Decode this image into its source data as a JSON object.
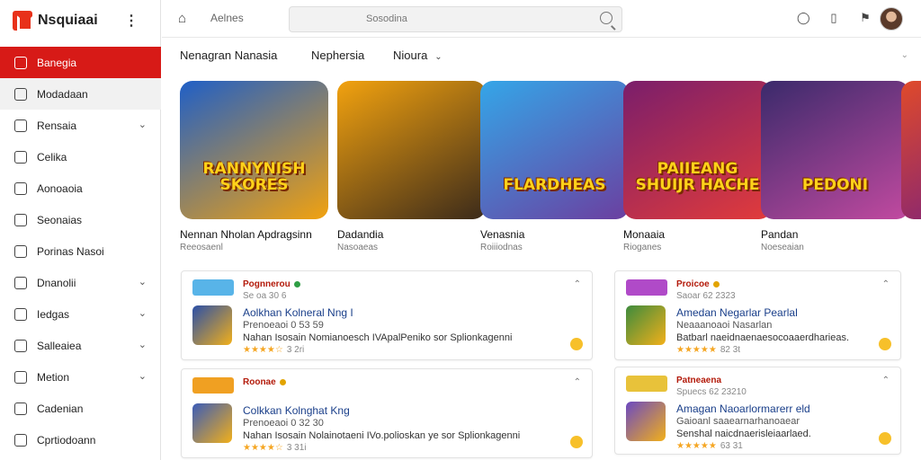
{
  "brand": {
    "name": "Nsquiaai"
  },
  "sidebar": {
    "items": [
      {
        "label": "Banegia",
        "icon": "home-icon",
        "active": true,
        "chevron": false
      },
      {
        "label": "Modadaan",
        "icon": "library-icon",
        "active": false,
        "chevron": false
      },
      {
        "label": "Rensaia",
        "icon": "home-outline-icon",
        "active": false,
        "chevron": true
      },
      {
        "label": "Celika",
        "icon": "grid-icon",
        "active": false,
        "chevron": false
      },
      {
        "label": "Aonoaoia",
        "icon": "document-icon",
        "active": false,
        "chevron": false
      },
      {
        "label": "Seonaias",
        "icon": "phone-icon",
        "active": false,
        "chevron": false
      },
      {
        "label": "Porinas Nasoi",
        "icon": "home-outline-icon",
        "active": false,
        "chevron": false
      },
      {
        "label": "Dnanolii",
        "icon": "edit-icon",
        "active": false,
        "chevron": true
      },
      {
        "label": "Iedgas",
        "icon": "folder-icon",
        "active": false,
        "chevron": true
      },
      {
        "label": "Salleaiea",
        "icon": "bell-icon",
        "active": false,
        "chevron": true
      },
      {
        "label": "Metion",
        "icon": "bell-icon",
        "active": false,
        "chevron": true
      },
      {
        "label": "Cadenian",
        "icon": "share-icon",
        "active": false,
        "chevron": false
      },
      {
        "label": "Cprtiodoann",
        "icon": "settings-icon",
        "active": false,
        "chevron": false
      }
    ]
  },
  "topbar": {
    "label": "Aelnes",
    "search_placeholder": "Sosodina"
  },
  "tabs": [
    {
      "label": "Nenagran Nanasia"
    },
    {
      "label": "Nephersia"
    },
    {
      "label": "Nioura"
    }
  ],
  "games": [
    {
      "art_title": "RANNYNISH SKORES",
      "name": "Nennan Nholan Apdragsinn",
      "sub": "Reeosaenl",
      "bg": "#1f5fc7",
      "bg2": "#f2a20f"
    },
    {
      "art_title": "",
      "name": "Dadandia",
      "sub": "Nasoaeas",
      "bg": "#f2a20f",
      "bg2": "#3b2a1a"
    },
    {
      "art_title": "FLARDHEAS",
      "name": "Venasnia",
      "sub": "Roiiiodnas",
      "bg": "#34a6e8",
      "bg2": "#6b3fa0"
    },
    {
      "art_title": "PAIIEANG SHUIJR HACHE",
      "name": "Monaaia",
      "sub": "Rioganes",
      "bg": "#7a1e6b",
      "bg2": "#e23b3b"
    },
    {
      "art_title": "PEDONI",
      "name": "Pandan",
      "sub": "Noeseaian",
      "bg": "#3a2a6b",
      "bg2": "#c24aa0"
    }
  ],
  "cards": [
    {
      "tag": "Pognnerou",
      "dot": "#2f9e44",
      "meta": "Se oa 30 6",
      "title": "Aolkhan Kolneral Nng I",
      "line1": "Prenoeaoi 0 53 59",
      "line2": "Nahan Isosain Nomianoesch IVApalPeniko sor Splionkagenni",
      "stars": "★★★★☆",
      "rating": "3 2ri",
      "logo_bg": "#58b4e8",
      "thumb_bg": "#2a4fa8"
    },
    {
      "tag": "Proicoe",
      "dot": "#e2a400",
      "meta": "Saoar 62 2323",
      "title": "Amedan Negarlar Pearlal",
      "line1": "Neaaanoaoi Nasarlan",
      "line2": "Batbarl naeidnaenaesocoaaerdharieas.",
      "stars": "★★★★★",
      "rating": "82 3t",
      "logo_bg": "#b04ac8",
      "thumb_bg": "#3d8b3d"
    },
    {
      "tag": "Roonae",
      "dot": "#e2a400",
      "meta": "",
      "title": "Colkkan Kolnghat Kng",
      "line1": "Prenoeaoi 0 32 30",
      "line2": "Nahan Isosain Nolainotaeni IVo.polioskan ye sor Splionkagenni",
      "stars": "★★★★☆",
      "rating": "3 31i",
      "logo_bg": "#f0a022",
      "thumb_bg": "#3a5bb8"
    },
    {
      "tag": "Patneaena",
      "dot": "",
      "meta": "Spuecs 62 23210",
      "title": "Amagan Naoarlormarerr eld",
      "line1": "Gaioanl saaearnarhanoaear",
      "line2": "Senshal naicdnaerisleiaarlaed.",
      "stars": "★★★★★",
      "rating": "63 31",
      "logo_bg": "#e8c23a",
      "thumb_bg": "#6b49c2"
    }
  ]
}
